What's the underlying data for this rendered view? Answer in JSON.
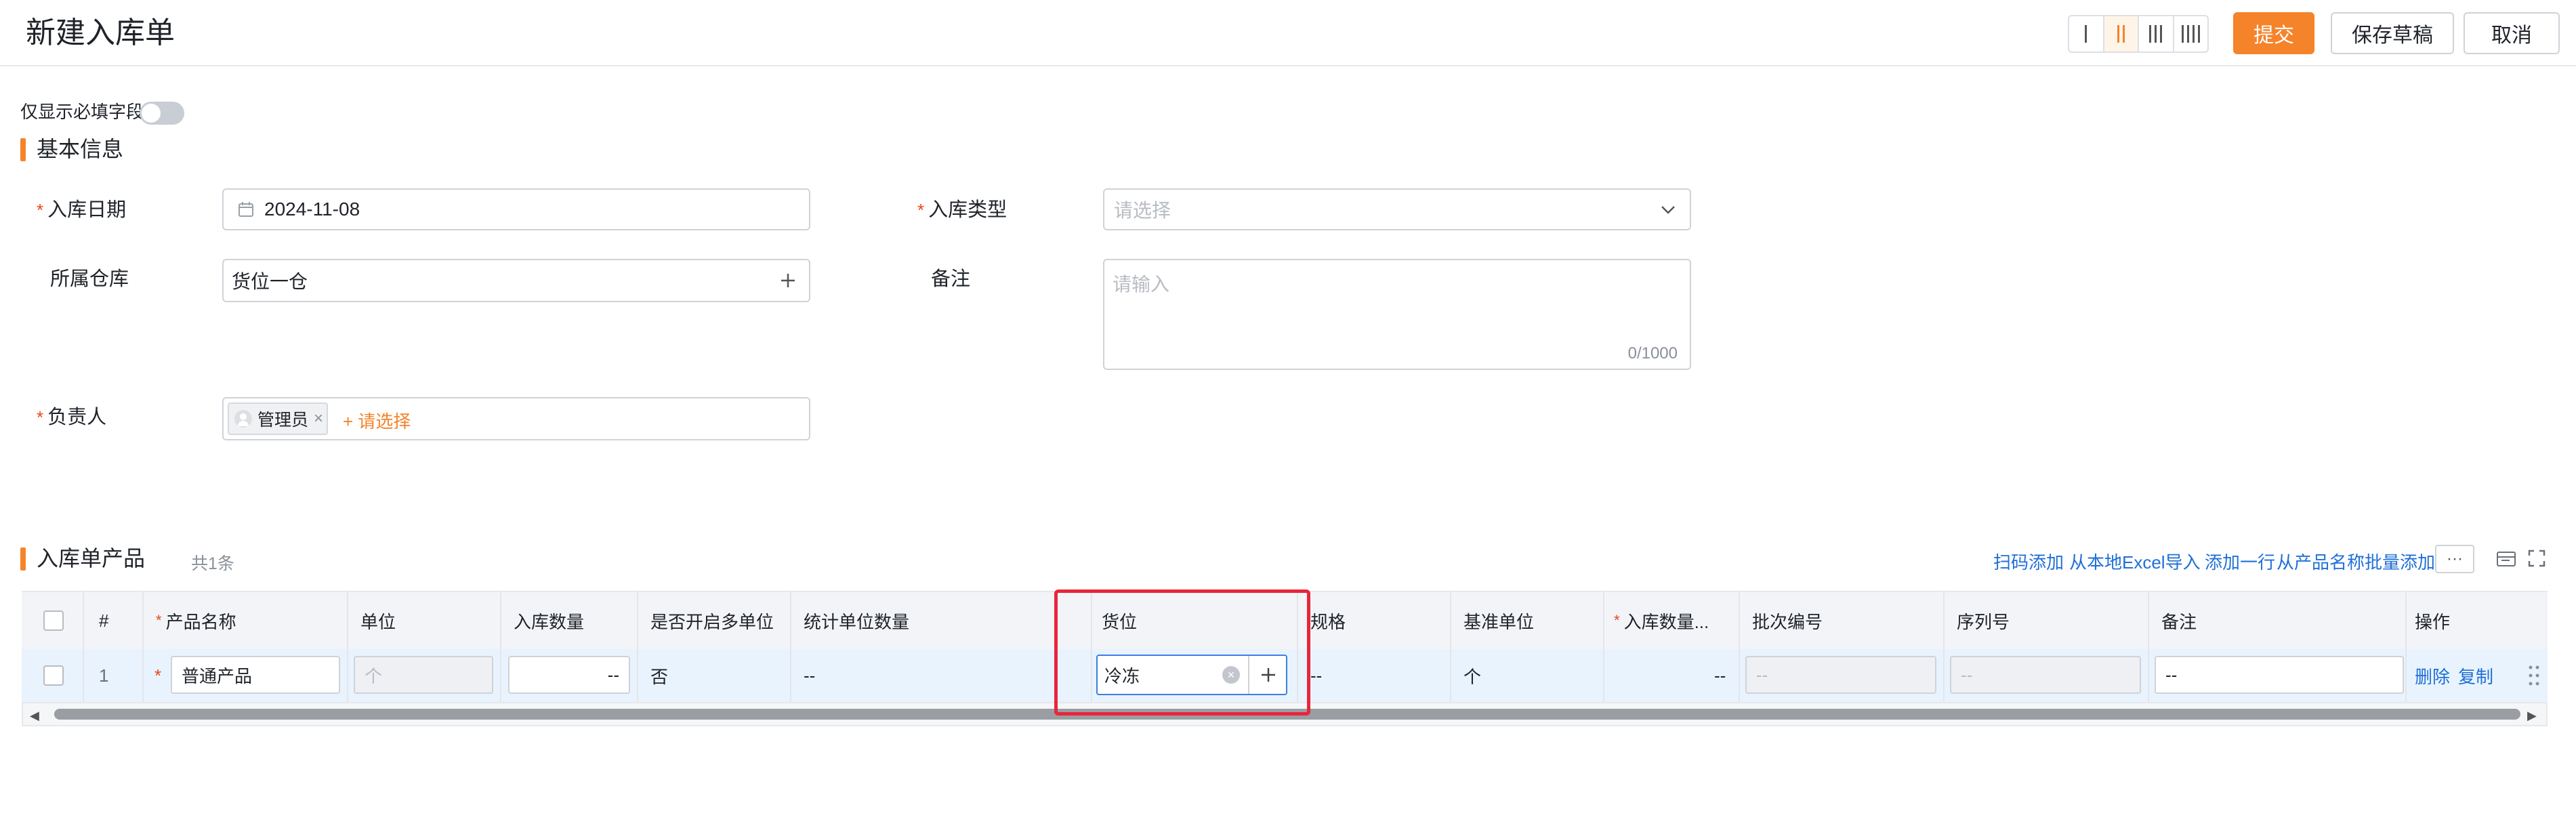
{
  "header": {
    "title": "新建入库单",
    "submit": "提交",
    "save_draft": "保存草稿",
    "cancel": "取消"
  },
  "toggle": {
    "label": "仅显示必填字段"
  },
  "basic": {
    "section_title": "基本信息",
    "date_label": "入库日期",
    "date_value": "2024-11-08",
    "type_label": "入库类型",
    "type_placeholder": "请选择",
    "warehouse_label": "所属仓库",
    "warehouse_value": "货位一仓",
    "remark_label": "备注",
    "remark_placeholder": "请输入",
    "remark_count": "0/1000",
    "owner_label": "负责人",
    "owner_tag": "管理员",
    "owner_add": "+ 请选择"
  },
  "products": {
    "section_title": "入库单产品",
    "count": "共1条",
    "actions": [
      "扫码添加",
      "从本地Excel导入",
      "添加一行",
      "从产品名称批量添加"
    ],
    "more": "···",
    "headers": {
      "index": "#",
      "name": "产品名称",
      "unit": "单位",
      "qty": "入库数量",
      "multi_unit": "是否开启多单位",
      "stat_qty": "统计单位数量",
      "location": "货位",
      "spec": "规格",
      "base_unit": "基准单位",
      "qty_base": "入库数量...",
      "batch": "批次编号",
      "serial": "序列号",
      "remark": "备注",
      "ops": "操作"
    },
    "row": {
      "index": "1",
      "name": "普通产品",
      "unit": "个",
      "qty": "--",
      "multi_unit": "否",
      "stat_qty": "--",
      "location": "冷冻",
      "spec": "--",
      "base_unit": "个",
      "qty_base": "--",
      "batch": "--",
      "serial": "--",
      "remark": "--",
      "delete": "删除",
      "copy": "复制"
    }
  },
  "colors": {
    "accent": "#f5832a",
    "link": "#1f6fd6",
    "highlight": "#e8253b",
    "required": "#e8471e"
  }
}
